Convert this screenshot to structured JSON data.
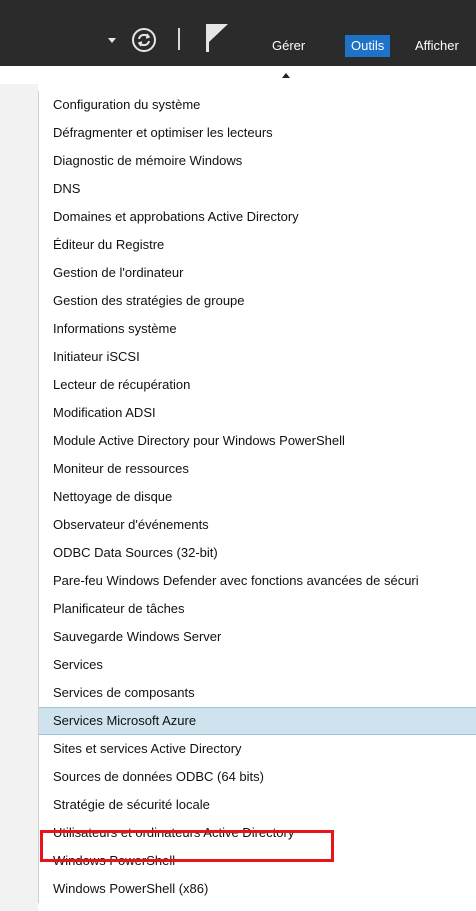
{
  "toolbar": {
    "menu": [
      {
        "label": "Gérer"
      },
      {
        "label": "Outils"
      },
      {
        "label": "Afficher"
      }
    ],
    "active_color": "#1e73c9"
  },
  "tools_menu": {
    "items": [
      "Configuration du système",
      "Défragmenter et optimiser les lecteurs",
      "Diagnostic de mémoire Windows",
      "DNS",
      "Domaines et approbations Active Directory",
      "Éditeur du Registre",
      "Gestion de l'ordinateur",
      "Gestion des stratégies de groupe",
      "Informations système",
      "Initiateur iSCSI",
      "Lecteur de récupération",
      "Modification ADSI",
      "Module Active Directory pour Windows PowerShell",
      "Moniteur de ressources",
      "Nettoyage de disque",
      "Observateur d'événements",
      "ODBC Data Sources (32-bit)",
      "Pare-feu Windows Defender avec fonctions avancées de sécuri",
      "Planificateur de tâches",
      "Sauvegarde Windows Server",
      "Services",
      "Services de composants",
      "Services Microsoft Azure",
      "Sites et services Active Directory",
      "Sources de données ODBC (64 bits)",
      "Stratégie de sécurité locale",
      "Utilisateurs et ordinateurs Active Directory",
      "Windows PowerShell",
      "Windows PowerShell (x86)"
    ],
    "highlighted_item": "Services Microsoft Azure",
    "outlined_item": "Utilisateurs et ordinateurs Active Directory",
    "highlight_color": "#cfe3ef",
    "outline_color": "#e8141a"
  }
}
